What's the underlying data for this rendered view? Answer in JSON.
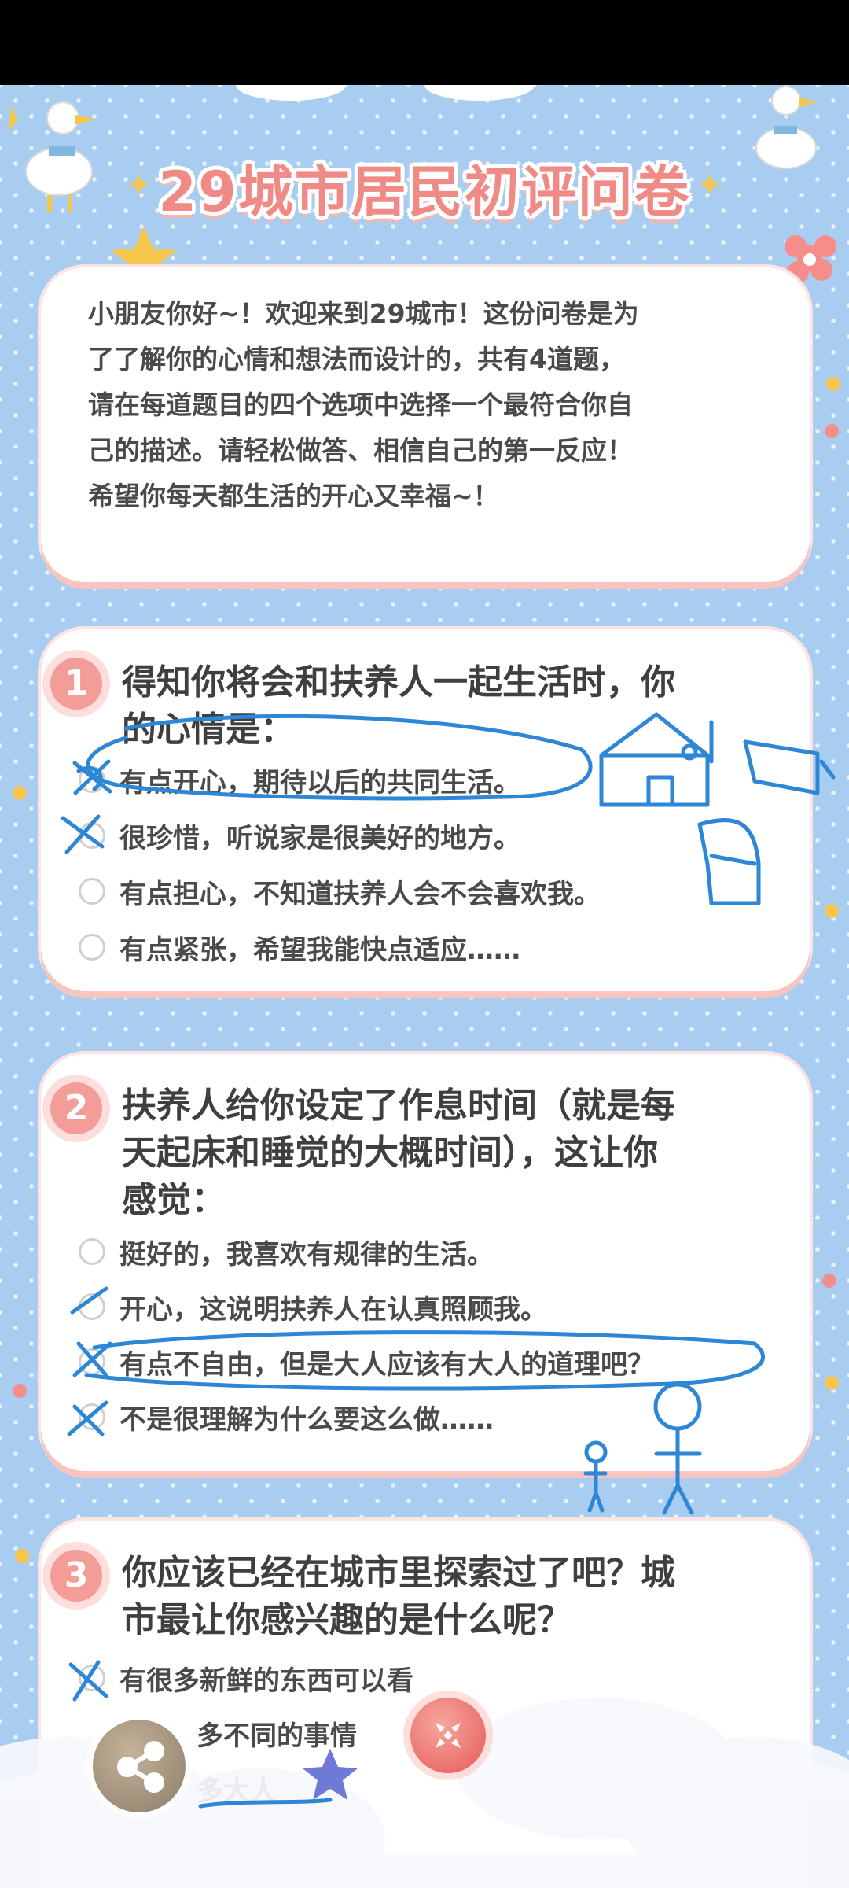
{
  "title": "29城市居民初评问卷",
  "intro": {
    "lines": [
      "小朋友你好~！欢迎来到29城市！这份问卷是为",
      "了了解你的心情和想法而设计的，共有4道题，",
      "请在每道题目的四个选项中选择一个最符合你自",
      "己的描述。请轻松做答、相信自己的第一反应！",
      "希望你每天都生活的开心又幸福~！"
    ]
  },
  "questions": [
    {
      "number": "1",
      "lines": [
        "得知你将会和扶养人一起生活时，你",
        "的心情是："
      ],
      "options": [
        "有点开心，期待以后的共同生活。",
        "很珍惜，听说家是很美好的地方。",
        "有点担心，不知道扶养人会不会喜欢我。",
        "有点紧张，希望我能快点适应……"
      ]
    },
    {
      "number": "2",
      "lines": [
        "扶养人给你设定了作息时间（就是每",
        "天起床和睡觉的大概时间），这让你",
        "感觉："
      ],
      "options": [
        "挺好的，我喜欢有规律的生活。",
        "开心，这说明扶养人在认真照顾我。",
        "有点不自由，但是大人应该有大人的道理吧？",
        "不是很理解为什么要这么做……"
      ]
    },
    {
      "number": "3",
      "lines": [
        "你应该已经在城市里探索过了吧？城",
        "市最让你感兴趣的是什么呢？"
      ],
      "options": [
        "有很多新鲜的东西可以看",
        "多不同的事情",
        "多大人"
      ]
    }
  ],
  "colors": {
    "accent": "#f49c98",
    "background": "#a9cdf0",
    "scribble": "#2e86d6"
  },
  "icons": [
    "share-icon",
    "close-icon",
    "goose-icon",
    "star-icon",
    "flower-icon"
  ]
}
